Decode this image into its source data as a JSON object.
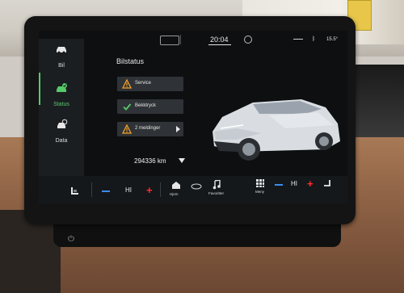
{
  "status_bar": {
    "clock": "20:04",
    "outside_temp": "15.5°"
  },
  "sidebar": {
    "items": [
      {
        "label": "Bil",
        "icon": "car-icon"
      },
      {
        "label": "Status",
        "icon": "car-status-icon"
      },
      {
        "label": "Data",
        "icon": "data-icon"
      }
    ],
    "active": "Status"
  },
  "main": {
    "title": "Bilstatus",
    "cards": [
      {
        "label": "Service",
        "icon": "warning-icon"
      },
      {
        "label": "Bekktryck",
        "icon": "check-icon"
      },
      {
        "label": "2 meldinger",
        "icon": "warning-icon",
        "arrow": true
      }
    ],
    "odometer": "294336 km"
  },
  "bottom_bar": {
    "left_temp": "HI",
    "right_temp": "HI",
    "home_label": "Hjem",
    "favorites_label": "Favoritter",
    "menu_label": "Meny"
  },
  "colors": {
    "accent_green": "#56c96b",
    "warning_amber": "#f2a12a",
    "minus_blue": "#3b8cf0",
    "plus_red": "#ff2d2d"
  }
}
